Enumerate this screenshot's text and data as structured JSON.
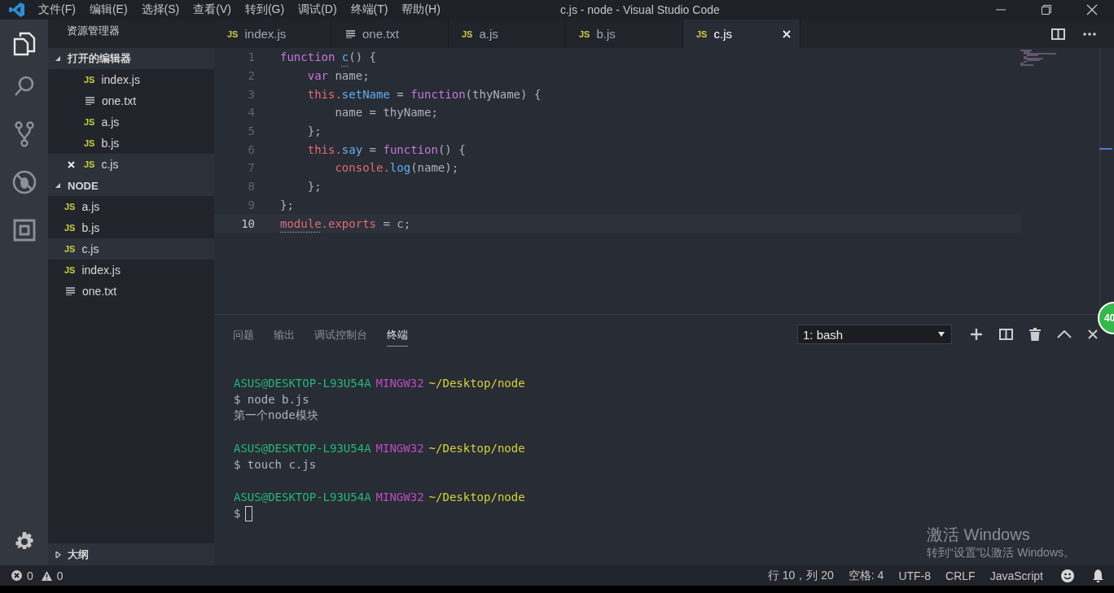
{
  "menu_bar": {
    "items": [
      "文件(F)",
      "编辑(E)",
      "选择(S)",
      "查看(V)",
      "转到(G)",
      "调试(D)",
      "终端(T)",
      "帮助(H)"
    ],
    "title": "c.js - node - Visual Studio Code"
  },
  "activity_bar": [
    {
      "kind": "files",
      "selected": true
    },
    {
      "kind": "search",
      "selected": false
    },
    {
      "kind": "scm",
      "selected": false
    },
    {
      "kind": "debug",
      "selected": false
    },
    {
      "kind": "extensions",
      "selected": false
    }
  ],
  "sidebar": {
    "title": "资源管理器",
    "open_editors": {
      "label": "打开的编辑器",
      "expanded": true,
      "items": [
        {
          "name": "index.js",
          "kind": "js",
          "icon_text": "JS",
          "selected": false
        },
        {
          "name": "one.txt",
          "kind": "txt",
          "selected": false
        },
        {
          "name": "a.js",
          "kind": "js",
          "icon_text": "JS",
          "selected": false
        },
        {
          "name": "b.js",
          "kind": "js",
          "icon_text": "JS",
          "selected": false
        },
        {
          "name": "c.js",
          "kind": "js",
          "icon_text": "JS",
          "selected": true
        }
      ]
    },
    "folder": {
      "label": "NODE",
      "expanded": true,
      "items": [
        {
          "name": "a.js",
          "kind": "js",
          "icon_text": "JS",
          "selected": false
        },
        {
          "name": "b.js",
          "kind": "js",
          "icon_text": "JS",
          "selected": false
        },
        {
          "name": "c.js",
          "kind": "js",
          "icon_text": "JS",
          "selected": true
        },
        {
          "name": "index.js",
          "kind": "js",
          "icon_text": "JS",
          "selected": false
        },
        {
          "name": "one.txt",
          "kind": "txt",
          "selected": false
        }
      ]
    },
    "outline": {
      "label": "大纲",
      "expanded": false
    }
  },
  "tabs": [
    {
      "name": "index.js",
      "kind": "js",
      "icon_text": "JS",
      "selected": false
    },
    {
      "name": "one.txt",
      "kind": "txt",
      "selected": false
    },
    {
      "name": "a.js",
      "kind": "js",
      "icon_text": "JS",
      "selected": false
    },
    {
      "name": "b.js",
      "kind": "js",
      "icon_text": "JS",
      "selected": false
    },
    {
      "name": "c.js",
      "kind": "js",
      "icon_text": "JS",
      "selected": true
    }
  ],
  "editor": {
    "lines": [
      {
        "number": "1",
        "current": false,
        "tokens": [
          {
            "text": "function ",
            "kind": "keyword"
          },
          {
            "text": "c",
            "kind": "hinted-function"
          },
          {
            "text": "() {",
            "kind": "plain"
          }
        ]
      },
      {
        "number": "2",
        "current": false,
        "tokens": [
          {
            "text": "    var",
            "kind": "keyword"
          },
          {
            "text": " name;",
            "kind": "plain"
          }
        ]
      },
      {
        "number": "3",
        "current": false,
        "tokens": [
          {
            "text": "    this.",
            "kind": "variable"
          },
          {
            "text": "setName",
            "kind": "function"
          },
          {
            "text": " = ",
            "kind": "plain"
          },
          {
            "text": "function",
            "kind": "keyword"
          },
          {
            "text": "(thyName) {",
            "kind": "plain"
          }
        ]
      },
      {
        "number": "4",
        "current": false,
        "tokens": [
          {
            "text": "        name = thyName;",
            "kind": "plain"
          }
        ]
      },
      {
        "number": "5",
        "current": false,
        "tokens": [
          {
            "text": "    };",
            "kind": "plain"
          }
        ]
      },
      {
        "number": "6",
        "current": false,
        "tokens": [
          {
            "text": "    this.",
            "kind": "variable"
          },
          {
            "text": "say",
            "kind": "function"
          },
          {
            "text": " = ",
            "kind": "plain"
          },
          {
            "text": "function",
            "kind": "keyword"
          },
          {
            "text": "() {",
            "kind": "plain"
          }
        ]
      },
      {
        "number": "7",
        "current": false,
        "tokens": [
          {
            "text": "        console.",
            "kind": "variable"
          },
          {
            "text": "log",
            "kind": "function"
          },
          {
            "text": "(name);",
            "kind": "plain"
          }
        ]
      },
      {
        "number": "8",
        "current": false,
        "tokens": [
          {
            "text": "    };",
            "kind": "plain"
          }
        ]
      },
      {
        "number": "9",
        "current": false,
        "tokens": [
          {
            "text": "};",
            "kind": "plain"
          }
        ]
      },
      {
        "number": "10",
        "current": true,
        "tokens": [
          {
            "text": "module",
            "kind": "hinted-variable"
          },
          {
            "text": ".exports",
            "kind": "variable"
          },
          {
            "text": " = c;",
            "kind": "plain"
          }
        ]
      }
    ]
  },
  "panel": {
    "tabs": [
      {
        "label": "问题",
        "selected": false
      },
      {
        "label": "输出",
        "selected": false
      },
      {
        "label": "调试控制台",
        "selected": false
      },
      {
        "label": "终端",
        "selected": true
      }
    ],
    "terminal_select": "1: bash",
    "terminal": [
      {
        "user": "ASUS@DESKTOP-L93U54A",
        "host": "MINGW32",
        "path": "~/Desktop/node",
        "lines": [
          "$ node b.js",
          "第一个node模块"
        ]
      },
      {
        "user": "ASUS@DESKTOP-L93U54A",
        "host": "MINGW32",
        "path": "~/Desktop/node",
        "lines": [
          "$ touch c.js"
        ]
      },
      {
        "user": "ASUS@DESKTOP-L93U54A",
        "host": "MINGW32",
        "path": "~/Desktop/node",
        "lines": [
          "$"
        ],
        "cursor": true
      }
    ]
  },
  "activation_notice": {
    "title": "激活 Windows",
    "subtitle": "转到“设置”以激活 Windows。"
  },
  "floating_badge": "40",
  "status_bar": {
    "errors": "0",
    "warnings": "0",
    "items": [
      "行 10，列 20",
      "空格: 4",
      "UTF-8",
      "CRLF",
      "JavaScript"
    ]
  }
}
